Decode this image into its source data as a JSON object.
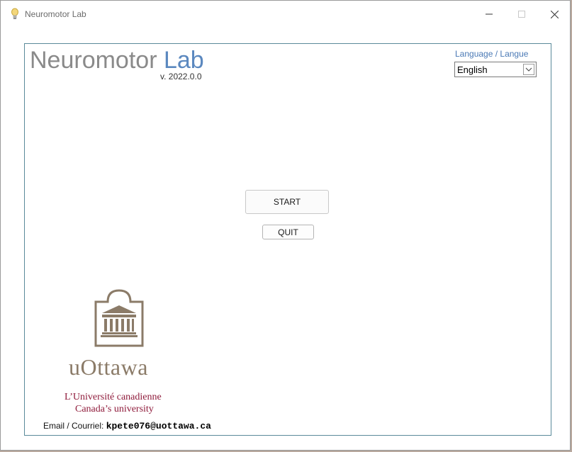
{
  "window": {
    "title": "Neuromotor Lab",
    "icon": "lightbulb-icon"
  },
  "header": {
    "title_part1": "Neuromotor",
    "title_part2": "Lab",
    "version": "v. 2022.0.0"
  },
  "language": {
    "label": "Language / Langue",
    "selected": "English"
  },
  "actions": {
    "start_label": "START",
    "quit_label": "QUIT"
  },
  "logo": {
    "wordmark": "uOttawa",
    "tagline_fr": "L’Université canadienne",
    "tagline_en": "Canada’s university"
  },
  "contact": {
    "label": "Email / Courriel:",
    "email": "kpete076@uottawa.ca"
  },
  "colors": {
    "title_gray": "#8a8a8a",
    "title_blue": "#5b88bf",
    "logo_brown": "#8b7b68",
    "tagline_red": "#8f1b3b",
    "panel_border": "#5a8a9a"
  }
}
